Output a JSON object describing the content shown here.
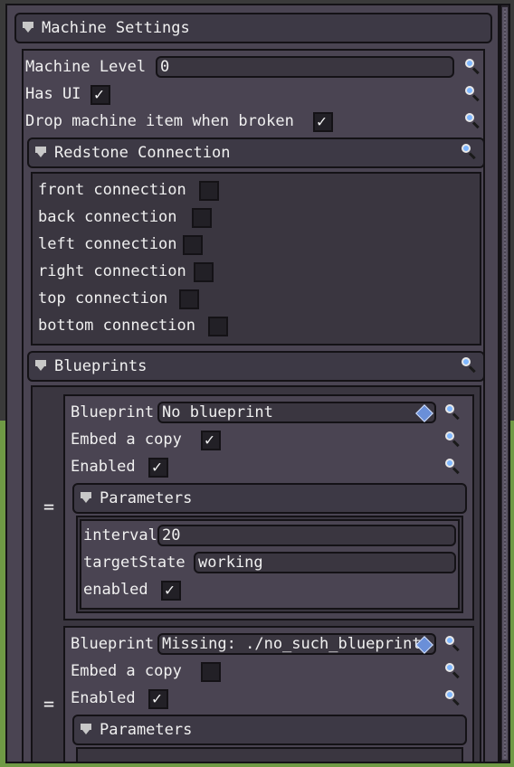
{
  "machine_settings": {
    "title": "Machine Settings",
    "machine_level": {
      "label": "Machine Level",
      "value": "0"
    },
    "has_ui": {
      "label": "Has UI",
      "checked": true
    },
    "drop_item": {
      "label": "Drop machine item when broken",
      "checked": true
    }
  },
  "redstone": {
    "title": "Redstone Connection",
    "connections": [
      {
        "label": "front connection",
        "checked": false
      },
      {
        "label": "back connection",
        "checked": false
      },
      {
        "label": "left connection",
        "checked": false
      },
      {
        "label": "right connection",
        "checked": false
      },
      {
        "label": "top connection",
        "checked": false
      },
      {
        "label": "bottom connection",
        "checked": false
      }
    ]
  },
  "blueprints": {
    "title": "Blueprints",
    "items": [
      {
        "handle": "=",
        "blueprint_label": "Blueprint",
        "blueprint_value": "No blueprint",
        "embed_label": "Embed a copy",
        "embed_checked": true,
        "enabled_label": "Enabled",
        "enabled_checked": true,
        "parameters_title": "Parameters",
        "params": {
          "interval_label": "interval",
          "interval_value": "20",
          "target_label": "targetState",
          "target_value": "working",
          "enabled_label": "enabled",
          "enabled_checked": true
        }
      },
      {
        "handle": "=",
        "blueprint_label": "Blueprint",
        "blueprint_value": "Missing: ./no_such_blueprint",
        "embed_label": "Embed a copy",
        "embed_checked": false,
        "enabled_label": "Enabled",
        "enabled_checked": true,
        "parameters_title": "Parameters"
      }
    ]
  },
  "check_glyph": "✓",
  "colors": {
    "window": "#4a4452",
    "panel": "#3a3640",
    "field": "#3a3640",
    "border": "#141216"
  }
}
